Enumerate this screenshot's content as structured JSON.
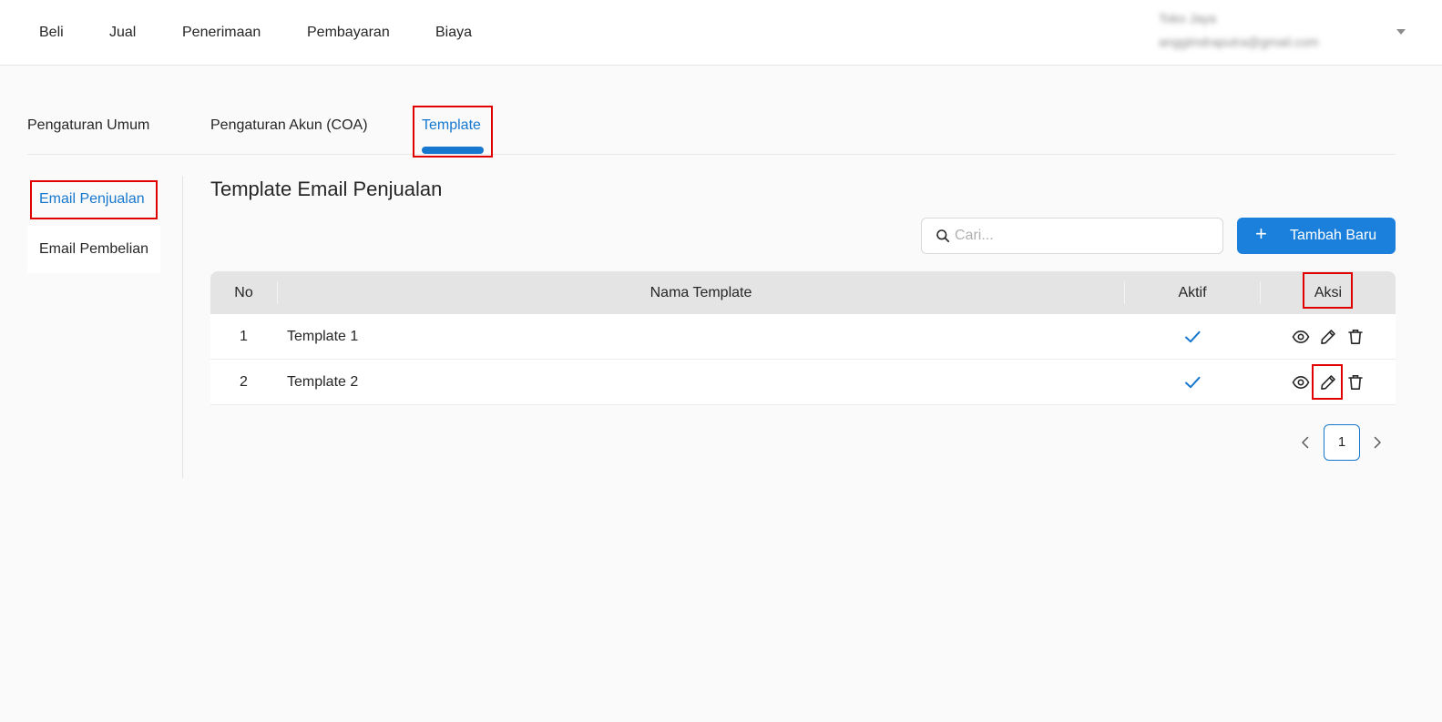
{
  "topnav": {
    "items": [
      "Beli",
      "Jual",
      "Penerimaan",
      "Pembayaran",
      "Biaya"
    ]
  },
  "user": {
    "name": "Toko Jaya",
    "email": "anggiindraputra@gmail.com"
  },
  "tabs": [
    "Pengaturan Umum",
    "Pengaturan Akun (COA)",
    "Template"
  ],
  "active_tab": "Template",
  "sidemenu": {
    "items": [
      "Email Penjualan",
      "Email Pembelian"
    ],
    "active": "Email Penjualan"
  },
  "section": {
    "title": "Template Email Penjualan"
  },
  "search": {
    "placeholder": "Cari...",
    "value": ""
  },
  "add_button": {
    "label": "Tambah Baru"
  },
  "table": {
    "columns": [
      "No",
      "Nama Template",
      "Aktif",
      "Aksi"
    ],
    "rows": [
      {
        "no": "1",
        "name": "Template 1",
        "active": true
      },
      {
        "no": "2",
        "name": "Template 2",
        "active": true
      }
    ],
    "actions": [
      "eye-icon",
      "pencil-icon",
      "trash-icon"
    ]
  },
  "pagination": {
    "current": "1"
  },
  "colors": {
    "accent": "#1677ce",
    "button": "#1a80dc",
    "highlight": "#e10000"
  }
}
